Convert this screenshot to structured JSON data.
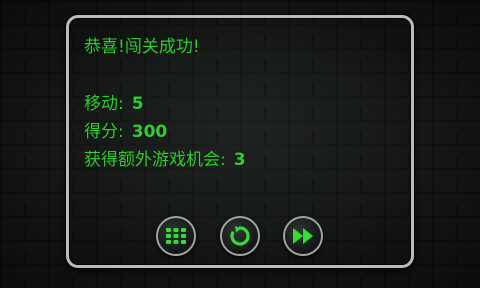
{
  "dialog": {
    "title": "恭喜!闯关成功!",
    "stats": [
      {
        "label": "移动:",
        "value": "5"
      },
      {
        "label": "得分:",
        "value": "300"
      },
      {
        "label": "获得额外游戏机会:",
        "value": "3"
      }
    ]
  },
  "buttons": {
    "menu_icon": "grid-menu-icon",
    "retry_icon": "restart-icon",
    "next_icon": "fast-forward-icon"
  },
  "colors": {
    "text": "#2cd12c",
    "icon": "#33dd33",
    "panel_border": "#b9bcba",
    "background": "#171918"
  }
}
